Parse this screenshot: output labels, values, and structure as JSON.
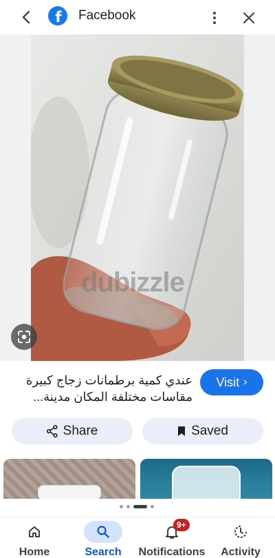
{
  "header": {
    "title": "Facebook",
    "logo_letter": "f"
  },
  "image": {
    "watermark": "dubizzle"
  },
  "result": {
    "description_line1": "عندي كمية برطمانات زجاج كبيرة",
    "description_line2": "مقاسات مختلفة المكان مدينة...",
    "visit_label": "Visit"
  },
  "actions": {
    "share_label": "Share",
    "saved_label": "Saved"
  },
  "nav": {
    "items": [
      {
        "label": "Home"
      },
      {
        "label": "Search"
      },
      {
        "label": "Notifications",
        "badge": "9+"
      },
      {
        "label": "Activity"
      }
    ]
  },
  "colors": {
    "accent": "#1a73e8",
    "facebook": "#1877f2",
    "pill_bg": "#e9eef8",
    "badge": "#c5221f"
  }
}
